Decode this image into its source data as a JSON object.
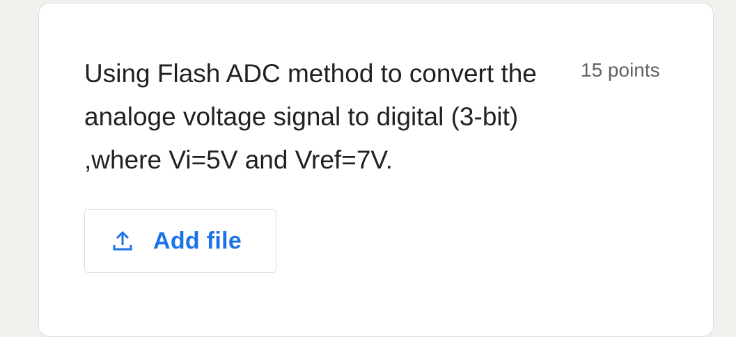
{
  "question": {
    "text": "Using Flash ADC method to convert the analoge voltage signal to digital (3-bit) ,where Vi=5V and Vref=7V.",
    "points": "15 points"
  },
  "actions": {
    "add_file_label": "Add file",
    "add_file_icon": "upload-icon"
  },
  "colors": {
    "accent": "#1a73e8",
    "text": "#202124",
    "muted": "#5f6368",
    "border": "#dadce0",
    "background": "#f0f0ec"
  }
}
